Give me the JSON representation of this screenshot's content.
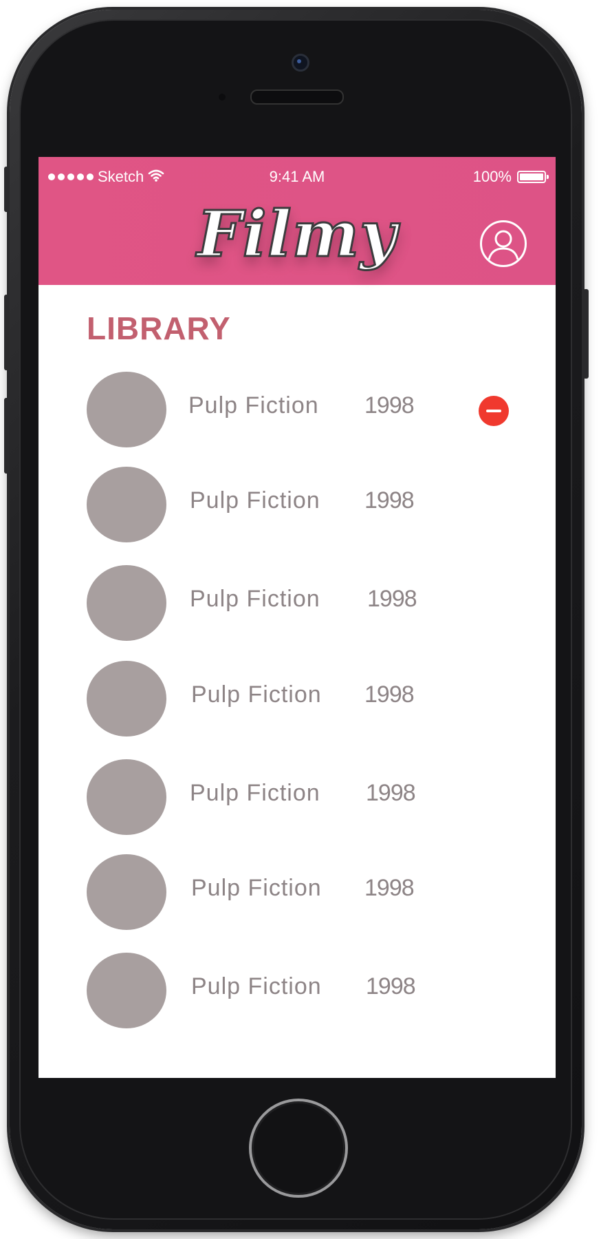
{
  "status_bar": {
    "carrier": "Sketch",
    "time": "9:41 AM",
    "battery": "100%",
    "battery_level": 1.0
  },
  "header": {
    "brand": "Filmy",
    "profile_icon": "user-circle-icon"
  },
  "library": {
    "title": "LIBRARY",
    "items": [
      {
        "title": "Pulp Fiction",
        "year": "1998",
        "show_delete": true
      },
      {
        "title": "Pulp Fiction",
        "year": "1998",
        "show_delete": false
      },
      {
        "title": "Pulp Fiction",
        "year": "1998",
        "show_delete": false
      },
      {
        "title": "Pulp Fiction",
        "year": "1998",
        "show_delete": false
      },
      {
        "title": "Pulp Fiction",
        "year": "1998",
        "show_delete": false
      },
      {
        "title": "Pulp Fiction",
        "year": "1998",
        "show_delete": false
      },
      {
        "title": "Pulp Fiction",
        "year": "1998",
        "show_delete": false
      }
    ]
  },
  "colors": {
    "header": "#e05585",
    "section_title": "#c2606f",
    "thumbnail": "#a89f9f",
    "text": "#8d8486",
    "delete": "#f0392e"
  }
}
